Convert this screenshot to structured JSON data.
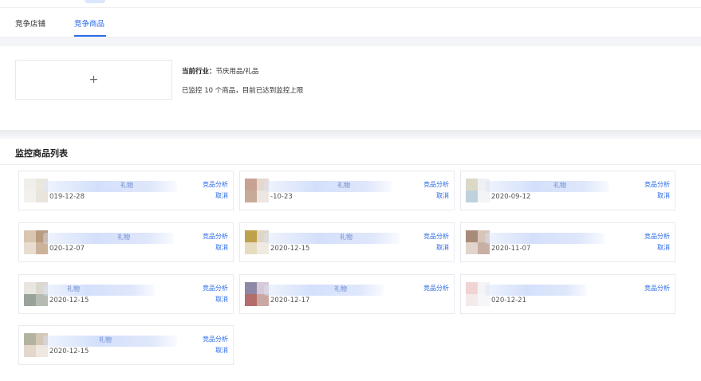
{
  "tabs": {
    "shops": "竞争店铺",
    "goods": "竞争商品"
  },
  "config": {
    "add_symbol": "+",
    "industry_label": "当前行业：",
    "industry_value": "节庆用品/礼品",
    "monitor_note": "已监控 10 个商品，目前已达到监控上限"
  },
  "list_title": "监控商品列表",
  "actions": {
    "analyze": "竞品分析",
    "cancel": "取消"
  },
  "products": [
    {
      "name_fragment": "礼物",
      "date": "019-12-28",
      "cancel": true
    },
    {
      "name_fragment": "礼物",
      "date": "-10-23",
      "cancel": true
    },
    {
      "name_fragment": "礼物",
      "date": "2020-09-12",
      "cancel": true
    },
    {
      "name_fragment": "礼物",
      "date": "020-12-07",
      "cancel": true
    },
    {
      "name_fragment": "礼物",
      "date": "2020-12-15",
      "cancel": true
    },
    {
      "name_fragment": "",
      "date": "2020-11-07",
      "cancel": true
    },
    {
      "name_fragment": "礼物",
      "date": "2020-12-15",
      "cancel": true
    },
    {
      "name_fragment": "礼物",
      "date": "2020-12-17",
      "cancel": false
    },
    {
      "name_fragment": "",
      "date": "020-12-21",
      "cancel": false
    },
    {
      "name_fragment": "礼物",
      "date": "2020-12-15",
      "cancel": true
    }
  ],
  "colors": {
    "accent": "#2b6be6",
    "thumbs": [
      [
        "#f1efe9",
        "#ebe7df",
        "#f3f1ec",
        "#e9e5dc"
      ],
      [
        "#c9a193",
        "#e6d8d0",
        "#c8aa99",
        "#eee6e0"
      ],
      [
        "#dcd8c8",
        "#eef0f3",
        "#bfd2dc",
        "#f3f4f6"
      ],
      [
        "#d9c6b2",
        "#b99b80",
        "#e8ddd0",
        "#cbb39a"
      ],
      [
        "#bfa14a",
        "#ded7c6",
        "#e7dcc0",
        "#efebe2"
      ],
      [
        "#a88a7a",
        "#d8c4b8",
        "#e2d4cc",
        "#c7b0a3"
      ],
      [
        "#e9e6e0",
        "#dcd8d0",
        "#9aa39a",
        "#b7bcb3"
      ],
      [
        "#8e88a6",
        "#d6c9d8",
        "#b46d6a",
        "#c9a8a4"
      ],
      [
        "#f1d3d3",
        "#f4f4f6",
        "#f3eaea",
        "#f6f6f8"
      ],
      [
        "#b3b4a0",
        "#d3c8b7",
        "#e4d8cc",
        "#efe8e0"
      ]
    ]
  }
}
